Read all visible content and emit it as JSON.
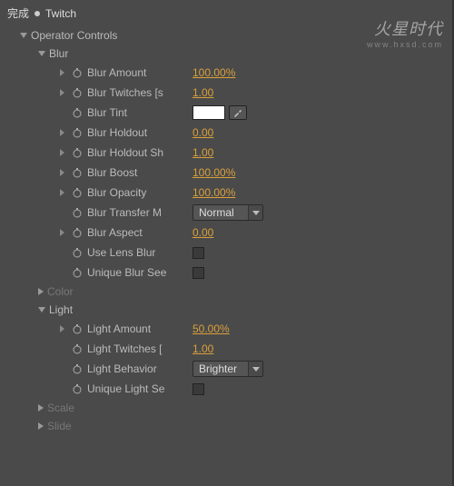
{
  "header": {
    "title_prefix": "完成",
    "title_name": "Twitch"
  },
  "watermark": {
    "line1": "火星时代",
    "line2": "www.hxsd.com"
  },
  "operator_controls": {
    "label": "Operator Controls"
  },
  "blur": {
    "label": "Blur",
    "amount": {
      "label": "Blur Amount",
      "value": "100.00%"
    },
    "twitches": {
      "label": "Blur Twitches [s",
      "value": "1.00"
    },
    "tint": {
      "label": "Blur Tint"
    },
    "holdout": {
      "label": "Blur Holdout",
      "value": "0.00"
    },
    "holdout_sh": {
      "label": "Blur Holdout Sh",
      "value": "1.00"
    },
    "boost": {
      "label": "Blur Boost",
      "value": "100.00%"
    },
    "opacity": {
      "label": "Blur Opacity",
      "value": "100.00%"
    },
    "transfer": {
      "label": "Blur Transfer M",
      "value": "Normal"
    },
    "aspect": {
      "label": "Blur Aspect",
      "value": "0.00"
    },
    "use_lens": {
      "label": "Use Lens Blur"
    },
    "unique_seed": {
      "label": "Unique Blur See"
    }
  },
  "color": {
    "label": "Color"
  },
  "light": {
    "label": "Light",
    "amount": {
      "label": "Light Amount",
      "value": "50.00%"
    },
    "twitches": {
      "label": "Light Twitches [",
      "value": "1.00"
    },
    "behavior": {
      "label": "Light Behavior",
      "value": "Brighter"
    },
    "unique_seed": {
      "label": "Unique Light Se"
    }
  },
  "scale": {
    "label": "Scale"
  },
  "slide": {
    "label": "Slide"
  }
}
